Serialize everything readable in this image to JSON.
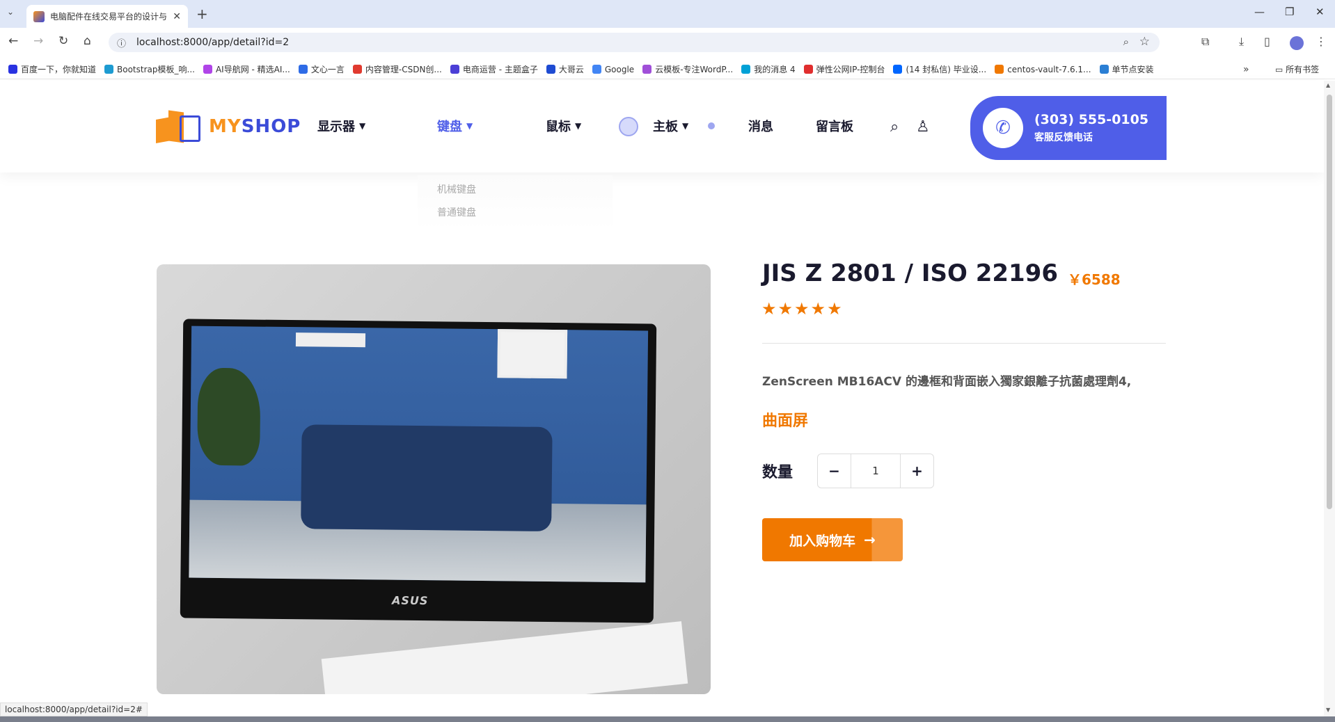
{
  "browser": {
    "tab_title": "电脑配件在线交易平台的设计与",
    "url": "localhost:8000/app/detail?id=2",
    "bookmarks": [
      {
        "label": "百度一下，你就知道",
        "color": "#2932e1"
      },
      {
        "label": "Bootstrap模板_响...",
        "color": "#1d9bd1"
      },
      {
        "label": "AI导航网 - 精选AI...",
        "color": "#b044e8"
      },
      {
        "label": "文心一言",
        "color": "#2e6be6"
      },
      {
        "label": "内容管理-CSDN创...",
        "color": "#e03a2f"
      },
      {
        "label": "电商运营 - 主题盒子",
        "color": "#4b3fd6"
      },
      {
        "label": "大哥云",
        "color": "#1e4bd2"
      },
      {
        "label": "Google",
        "color": "#4285f4"
      },
      {
        "label": "云模板-专注WordP...",
        "color": "#a04fd8"
      },
      {
        "label": "我的消息 4",
        "color": "#00a1d6"
      },
      {
        "label": "弹性公网IP-控制台",
        "color": "#e02e2e"
      },
      {
        "label": "(14 封私信) 毕业设...",
        "color": "#0066ff"
      },
      {
        "label": "centos-vault-7.6.1...",
        "color": "#f07800"
      },
      {
        "label": "单节点安装",
        "color": "#2b7fd4"
      }
    ],
    "all_bookmarks": "所有书签",
    "status_url": "localhost:8000/app/detail?id=2#"
  },
  "header": {
    "logo_my": "MY",
    "logo_shop": "SHOP",
    "nav": [
      {
        "label": "显示器"
      },
      {
        "label": "键盘"
      },
      {
        "label": "鼠标"
      },
      {
        "label": "主板"
      },
      {
        "label": "消息"
      },
      {
        "label": "留言板"
      }
    ],
    "phone_number": "(303) 555-0105",
    "phone_sub": "客服反馈电话"
  },
  "dropdown": {
    "items": [
      "机械键盘",
      "普通键盘"
    ]
  },
  "product": {
    "image_brand": "ASUS",
    "title": "JIS Z 2801 / ISO 22196",
    "price": "￥6588",
    "rating": 5,
    "description": "ZenScreen MB16ACV 的邊框和背面嵌入獨家銀離子抗菌處理劑4,",
    "tag": "曲面屏",
    "quantity_label": "数量",
    "quantity": "1",
    "minus": "−",
    "plus": "+",
    "add_to_cart": "加入购物车"
  },
  "colors": {
    "accent": "#4f5ee8",
    "orange": "#f07800",
    "dark": "#1a1a2e"
  }
}
